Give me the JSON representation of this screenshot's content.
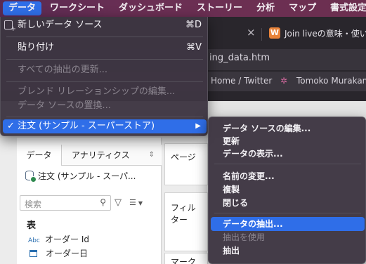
{
  "menubar": {
    "items": [
      "データ",
      "ワークシート",
      "ダッシュボード",
      "ストーリー",
      "分析",
      "マップ",
      "書式設定"
    ]
  },
  "browser": {
    "tab_close": "×",
    "tab_favicon": "W",
    "tab_title": "Join liveの意味・使い",
    "url": "ing_data.htm",
    "bookmark_1": "Home / Twitter",
    "bookmark_2": "Tomoko Murakam"
  },
  "tableau": {
    "tab_data": "データ",
    "tab_analytics": "アナリティクス",
    "datasource": "注文 (サンプル - スーパ...",
    "search_placeholder": "検索",
    "table_heading": "表",
    "fields": [
      {
        "type": "Abc",
        "name": "オーダー Id"
      },
      {
        "type": "",
        "name": "オーダー日"
      }
    ],
    "shelf_pages": "ページ",
    "shelf_filters": "フィルター",
    "shelf_marks": "マーク"
  },
  "menu": {
    "new_datasource": "新しいデータ ソース",
    "new_datasource_shortcut": "⌘D",
    "paste": "貼り付け",
    "paste_shortcut": "⌘V",
    "refresh_all_extracts": "すべての抽出の更新...",
    "edit_blend": "ブレンド リレーションシップの編集...",
    "replace_datasource": "データ ソースの置換...",
    "current_datasource": "注文 (サンプル - スーパーストア)"
  },
  "submenu": {
    "items": [
      {
        "label": "データ ソースの編集...",
        "enabled": true
      },
      {
        "label": "更新",
        "enabled": true
      },
      {
        "label": "データの表示...",
        "enabled": true
      },
      {
        "label": "名前の変更...",
        "enabled": true
      },
      {
        "label": "複製",
        "enabled": true
      },
      {
        "label": "閉じる",
        "enabled": true
      },
      {
        "label": "データの抽出...",
        "enabled": true,
        "highlighted": true
      },
      {
        "label": "抽出を使用",
        "enabled": false
      },
      {
        "label": "抽出",
        "enabled": true
      }
    ]
  }
}
